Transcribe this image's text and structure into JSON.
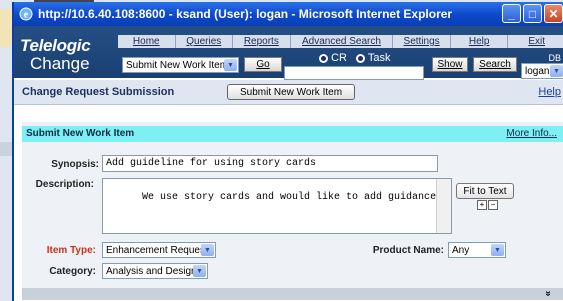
{
  "window": {
    "title": "http://10.6.40.108:8600 - ksand (User): logan - Microsoft Internet Explorer",
    "minimize_glyph": "_",
    "maximize_glyph": "□",
    "close_glyph": "✕"
  },
  "header": {
    "logo_line1": "Telelogic",
    "logo_line2": "Change",
    "nav": [
      "Home",
      "Queries",
      "Reports",
      "Advanced Search",
      "Settings",
      "Help",
      "Exit"
    ],
    "action_select": "Submit New Work Item",
    "go_label": "Go",
    "radio_cr": "CR",
    "radio_task": "Task",
    "show_label": "Show",
    "search_label": "Search",
    "db_label": "DB",
    "user_select": "logan"
  },
  "subbar": {
    "title": "Change Request Submission",
    "submit_button": "Submit New Work Item",
    "help": "Help"
  },
  "form": {
    "section_title": "Submit New Work Item",
    "more_info": "More Info...",
    "synopsis_label": "Synopsis:",
    "synopsis_value": "Add guideline for using story cards",
    "description_label": "Description:",
    "description_value": "We use story cards and would like to add guidance",
    "fit_to_text": "Fit to Text",
    "expand_glyph": "+",
    "collapse_glyph": "−",
    "item_type_label": "Item Type:",
    "item_type_value": "Enhancement Request",
    "product_name_label": "Product Name:",
    "product_name_value": "Any",
    "category_label": "Category:",
    "category_value": "Analysis and Design",
    "bottom_chevron": "»"
  },
  "colors": {
    "titlebar": "#0c48c9",
    "header_bg": "#1f4678",
    "section_header": "#7ef0f5",
    "required_label": "#d2301c"
  }
}
